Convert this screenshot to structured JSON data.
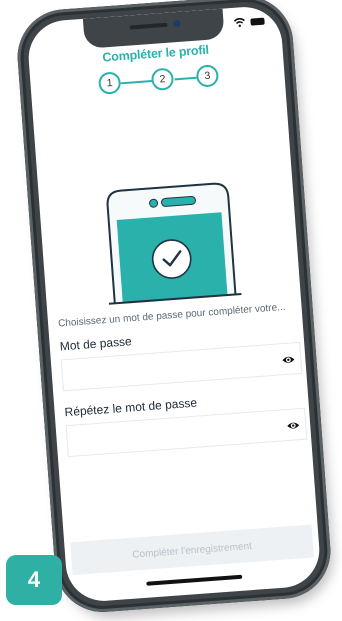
{
  "header": {
    "title": "Compléter le profil"
  },
  "stepper": {
    "steps": [
      "1",
      "2",
      "3"
    ],
    "active": 1
  },
  "form": {
    "prompt": "Choisissez un mot de passe pour compléter votre...",
    "password_label": "Mot de passe",
    "password_value": "",
    "repeat_label": "Répétez le mot de passe",
    "repeat_value": ""
  },
  "footer": {
    "submit_label": "Compléter l'enregistrement"
  },
  "badge": {
    "number": "4"
  },
  "colors": {
    "accent": "#2ab1ac",
    "badge": "#2fb0a4",
    "frame": "#3e4448"
  }
}
